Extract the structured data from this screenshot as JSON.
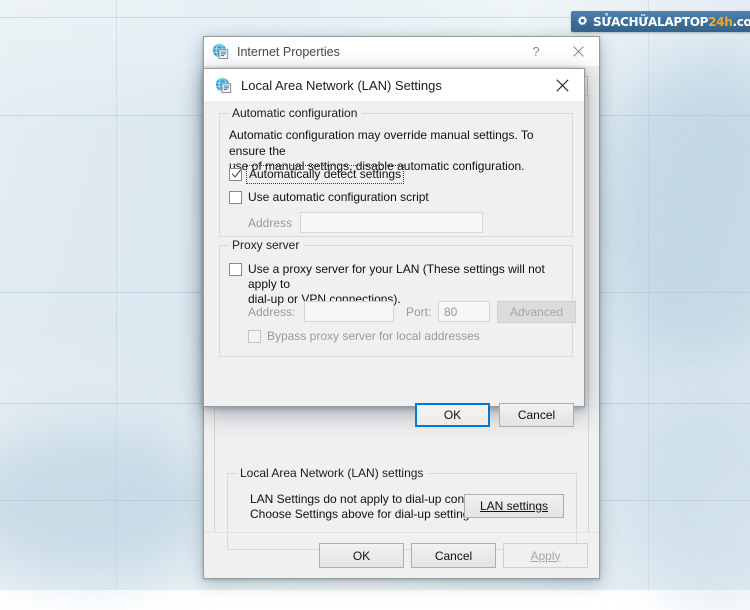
{
  "watermark": {
    "icon": "gear-icon",
    "text_part1": "SỬACHỮALAPTOP",
    "text_part2": "24h",
    "text_part3": ".com",
    "bg_color": "#3d7099",
    "accent_color": "#f5a623"
  },
  "internet_properties": {
    "title": "Internet Properties",
    "icon": "internet-properties-icon",
    "help_label": "?",
    "close_label": "✕",
    "lan_group": {
      "legend": "Local Area Network (LAN) settings",
      "description_line1": "LAN Settings do not apply to dial-up connections.",
      "description_line2": "Choose Settings above for dial-up settings.",
      "button_label": "LAN settings",
      "button_accesskey": "L"
    },
    "footer": {
      "ok_label": "OK",
      "cancel_label": "Cancel",
      "apply_label": "Apply",
      "apply_accesskey": "A",
      "apply_disabled": true
    }
  },
  "lan_dialog": {
    "title": "Local Area Network (LAN) Settings",
    "icon": "internet-properties-icon",
    "close_label": "✕",
    "automatic_configuration": {
      "legend": "Automatic configuration",
      "description_line1": "Automatic configuration may override manual settings.  To ensure the",
      "description_line2": "use of manual settings, disable automatic configuration.",
      "auto_detect": {
        "label": "Automatically detect settings",
        "accesskey": "A",
        "checked": true,
        "focused": true
      },
      "use_script": {
        "label": "Use automatic configuration script",
        "accesskey": "s",
        "checked": false
      },
      "address": {
        "label": "Address",
        "accesskey": "r",
        "value": "",
        "disabled": true
      }
    },
    "proxy_server": {
      "legend": "Proxy server",
      "use_proxy": {
        "label_line1": "Use a proxy server for your LAN (These settings will not apply to",
        "label_line2": "dial-up or VPN connections).",
        "accesskey": "x",
        "checked": false
      },
      "address": {
        "label": "Address:",
        "accesskey": "e",
        "value": "",
        "disabled": true
      },
      "port": {
        "label": "Port:",
        "accesskey": "t",
        "value": "80",
        "disabled": true
      },
      "advanced_button": {
        "label": "Advanced",
        "accesskey": "c",
        "disabled": true
      },
      "bypass": {
        "label": "Bypass proxy server for local addresses",
        "accesskey": "B",
        "checked": false,
        "disabled": true
      }
    },
    "footer": {
      "ok_label": "OK",
      "cancel_label": "Cancel",
      "ok_is_default": true
    }
  }
}
